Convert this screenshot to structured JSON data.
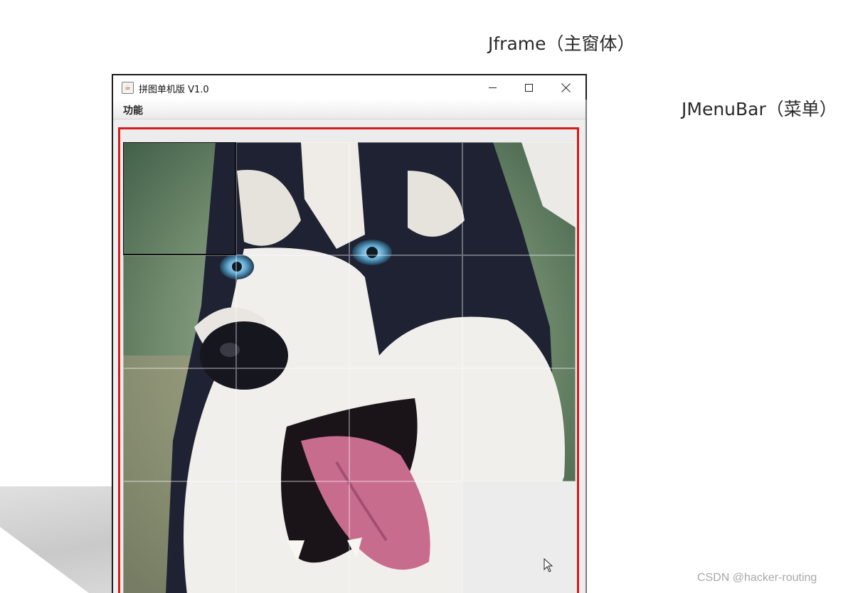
{
  "annotations": {
    "frame_label": "Jframe（主窗体）",
    "menubar_label": "JMenuBar（菜单）"
  },
  "window": {
    "title": "拼图单机版 V1.0",
    "icon": "java-cup-icon",
    "controls": {
      "minimize": "minimize-icon",
      "maximize": "maximize-icon",
      "close": "close-icon"
    }
  },
  "menubar": {
    "items": [
      {
        "label": "功能"
      }
    ]
  },
  "board": {
    "image": "husky-dog-photo",
    "columns": 4,
    "rows": 4,
    "tiles": [
      {
        "id": "t1",
        "src_col": 0,
        "src_row": 0,
        "state": "selected"
      },
      {
        "id": "t2",
        "src_col": 1,
        "src_row": 0,
        "state": "normal"
      },
      {
        "id": "t3",
        "src_col": 2,
        "src_row": 0,
        "state": "normal"
      },
      {
        "id": "t4",
        "src_col": 3,
        "src_row": 0,
        "state": "normal"
      },
      {
        "id": "t5",
        "src_col": 0,
        "src_row": 1,
        "state": "normal"
      },
      {
        "id": "t6",
        "src_col": 1,
        "src_row": 1,
        "state": "normal"
      },
      {
        "id": "t7",
        "src_col": 2,
        "src_row": 1,
        "state": "normal"
      },
      {
        "id": "t8",
        "src_col": 3,
        "src_row": 1,
        "state": "normal"
      },
      {
        "id": "t9",
        "src_col": 0,
        "src_row": 2,
        "state": "normal"
      },
      {
        "id": "t10",
        "src_col": 1,
        "src_row": 2,
        "state": "normal"
      },
      {
        "id": "t11",
        "src_col": 2,
        "src_row": 2,
        "state": "normal"
      },
      {
        "id": "t12",
        "src_col": 3,
        "src_row": 2,
        "state": "normal"
      },
      {
        "id": "t13",
        "src_col": 0,
        "src_row": 3,
        "state": "normal"
      },
      {
        "id": "t14",
        "src_col": 1,
        "src_row": 3,
        "state": "normal"
      },
      {
        "id": "t15",
        "src_col": 2,
        "src_row": 3,
        "state": "normal"
      },
      {
        "id": "t16",
        "src_col": 3,
        "src_row": 3,
        "state": "empty"
      }
    ]
  },
  "colors": {
    "annotation_border": "#d51c1c",
    "window_border": "#1a1a1a",
    "pane_background": "#ececec"
  },
  "watermark": "CSDN @hacker-routing"
}
